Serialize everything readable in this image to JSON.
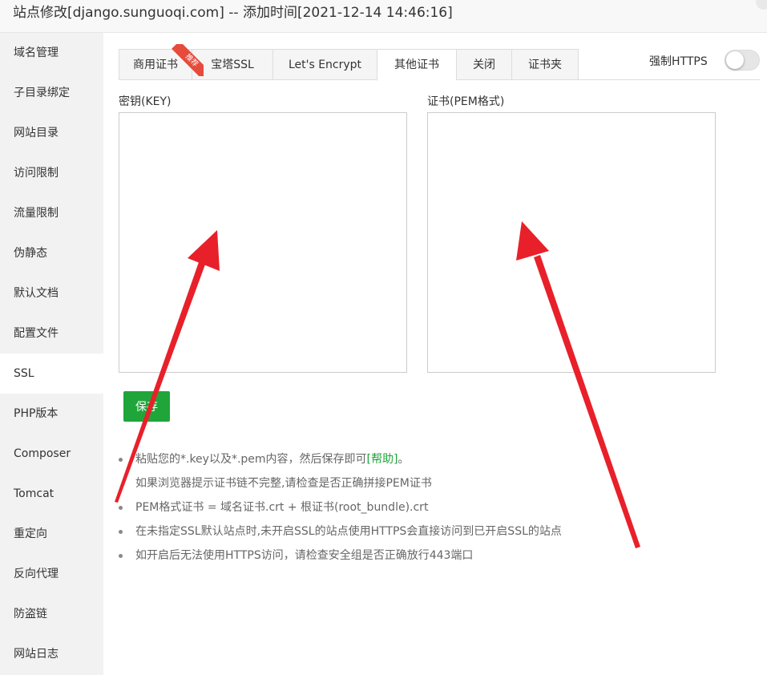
{
  "window": {
    "title": "站点修改[django.sunguoqi.com] -- 添加时间[2021-12-14 14:46:16]"
  },
  "sidebar": {
    "items": [
      {
        "label": "域名管理"
      },
      {
        "label": "子目录绑定"
      },
      {
        "label": "网站目录"
      },
      {
        "label": "访问限制"
      },
      {
        "label": "流量限制"
      },
      {
        "label": "伪静态"
      },
      {
        "label": "默认文档"
      },
      {
        "label": "配置文件"
      },
      {
        "label": "SSL",
        "active": true
      },
      {
        "label": "PHP版本"
      },
      {
        "label": "Composer"
      },
      {
        "label": "Tomcat"
      },
      {
        "label": "重定向"
      },
      {
        "label": "反向代理"
      },
      {
        "label": "防盗链"
      },
      {
        "label": "网站日志"
      }
    ]
  },
  "tabs": [
    {
      "label": "商用证书"
    },
    {
      "label": "宝塔SSL"
    },
    {
      "label": "Let's Encrypt"
    },
    {
      "label": "其他证书",
      "active": true
    },
    {
      "label": "关闭"
    },
    {
      "label": "证书夹"
    }
  ],
  "ribbon": {
    "label": "推荐"
  },
  "force_https": {
    "label": "强制HTTPS",
    "enabled": false
  },
  "key_field": {
    "label": "密钥(KEY)",
    "value": ""
  },
  "cert_field": {
    "label": "证书(PEM格式)",
    "value": ""
  },
  "save_button": {
    "label": "保存"
  },
  "tips": {
    "line1_prefix": "粘贴您的*.key以及*.pem内容，然后保存即可",
    "line1_link": "[帮助]",
    "line1_suffix": "。",
    "line2": "如果浏览器提示证书链不完整,请检查是否正确拼接PEM证书",
    "line3": "PEM格式证书 = 域名证书.crt + 根证书(root_bundle).crt",
    "line4": "在未指定SSL默认站点时,未开启SSL的站点使用HTTPS会直接访问到已开启SSL的站点",
    "line5": "如开启后无法使用HTTPS访问，请检查安全组是否正确放行443端口"
  },
  "colors": {
    "accent_green": "#20a53a",
    "annotation_red": "#e8202a",
    "ribbon_red": "#e64b3c"
  }
}
